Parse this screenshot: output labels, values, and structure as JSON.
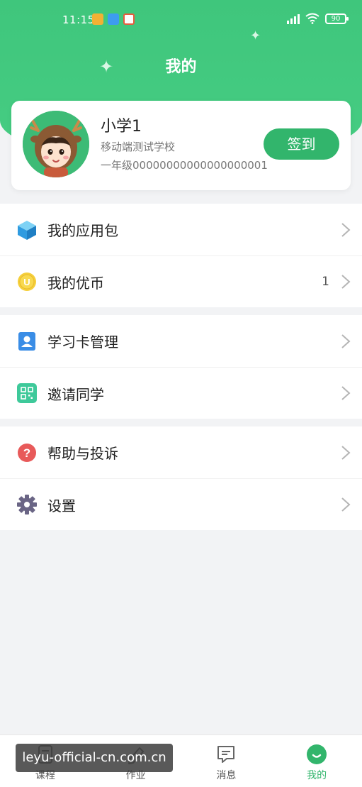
{
  "status_bar": {
    "time": "11:15",
    "battery": "90"
  },
  "header": {
    "title": "我的"
  },
  "profile": {
    "name": "小学1",
    "school": "移动端测试学校",
    "grade": "一年级00000000000000000001",
    "checkin_label": "签到"
  },
  "menu_groups": [
    {
      "items": [
        {
          "label": "我的应用包",
          "icon": "cube-icon",
          "value": ""
        },
        {
          "label": "我的优币",
          "icon": "coin-icon",
          "value": "1"
        }
      ]
    },
    {
      "items": [
        {
          "label": "学习卡管理",
          "icon": "user-card-icon",
          "value": ""
        },
        {
          "label": "邀请同学",
          "icon": "qr-code-icon",
          "value": ""
        }
      ]
    },
    {
      "items": [
        {
          "label": "帮助与投诉",
          "icon": "question-icon",
          "value": ""
        },
        {
          "label": "设置",
          "icon": "gear-icon",
          "value": ""
        }
      ]
    }
  ],
  "tabbar": {
    "tabs": [
      {
        "label": "课程",
        "icon": "course-icon",
        "active": false
      },
      {
        "label": "作业",
        "icon": "homework-icon",
        "active": false
      },
      {
        "label": "消息",
        "icon": "message-icon",
        "active": false
      },
      {
        "label": "我的",
        "icon": "profile-icon",
        "active": true
      }
    ]
  },
  "watermark": "leyu-official-cn.com.cn",
  "colors": {
    "brand_green": "#32b56c",
    "header_green": "#46cd83",
    "coin_yellow": "#f5cf3a",
    "help_red": "#e85a5a"
  }
}
